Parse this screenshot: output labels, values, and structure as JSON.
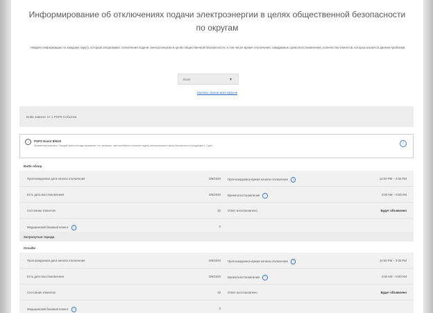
{
  "page": {
    "title": "Информирование об отключениях подачи электроэнергии в целях общественной безопасности по округам",
    "intro": "Найдите информацию по каждому округу, который затрагивают отключения подачи электроэнергии в целях общественной безопасности, в том числе время отключения, ожидаемые сроки восстановления, количество клиентов, которых касается данная проблема.",
    "county_select": {
      "value": "Butte"
    },
    "view_all_link": "Скачать список всех округов",
    "note": "Butte зависит от 1 PSPS Событие.",
    "event": {
      "name": "PSPS Event 8/6/20",
      "description": "Неизменная категория. Текущий прогноз погоды показывает, что, возможно, нам потребуется отключить подачу электроэнергии в целях безопасности в следующие 1–2 дня."
    },
    "overview_heading": "Butte обзор",
    "overview_rows": [
      {
        "label": "Прогнозируемая дата начала отключения",
        "value": "8/6/2020",
        "label2": "Прогнозируемое время начала отключения",
        "value2": "12:00 PM – 3:00 PM",
        "info2": true
      },
      {
        "label": "Есть дата восстановления",
        "value": "8/6/2020",
        "label2": "Время восстановления",
        "value2": "4:00 AM – 8:00 AM",
        "info2": true
      },
      {
        "label": "Состояние клиентов",
        "value": "10",
        "label2": "Ответ восстановлено",
        "value2": "Будет объявлено",
        "bold2": true
      },
      {
        "label": "Медицинский базовый клиент",
        "value": "0",
        "info": true
      }
    ],
    "affected_heading": "Затронутые города",
    "city_heading": "Oroville",
    "city_rows": [
      {
        "label": "Прогнозируемая дата начала отключения",
        "value": "8/6/2020",
        "label2": "Прогнозируемое время начала отключения",
        "value2": "12:00 PM – 3:00 PM",
        "info2": true
      },
      {
        "label": "Есть дата восстановления",
        "value": "8/6/2020",
        "label2": "Время восстановления",
        "value2": "4:00 AM – 8:00 AM",
        "info2": true
      },
      {
        "label": "Состояние клиентов",
        "value": "10",
        "label2": "Ответ восстановлено",
        "value2": "Будет объявлено",
        "bold2": true
      },
      {
        "label": "Медицинский базовый клиент",
        "value": "0",
        "info": true
      }
    ],
    "colors": {
      "link": "#2a67b8",
      "info_icon": "#3a78c6",
      "panel": "#f1f1f1"
    }
  }
}
